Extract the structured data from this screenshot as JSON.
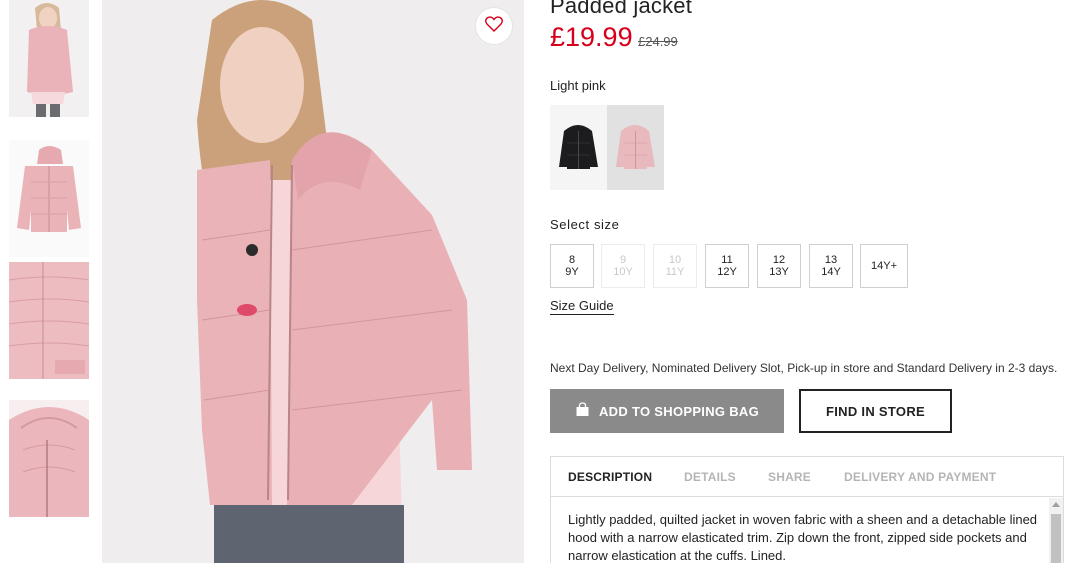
{
  "product": {
    "title": "Padded jacket",
    "price": "£19.99",
    "old_price": "£24.99"
  },
  "colors": {
    "selected_label": "Light pink",
    "swatches": [
      {
        "name": "black",
        "hex": "#1c1c1e"
      },
      {
        "name": "light-pink",
        "hex": "#e8b9bd"
      }
    ]
  },
  "sizes": {
    "label": "Select size",
    "options": [
      {
        "line1": "8",
        "line2": "9Y",
        "available": true
      },
      {
        "line1": "9",
        "line2": "10Y",
        "available": false
      },
      {
        "line1": "10",
        "line2": "11Y",
        "available": false
      },
      {
        "line1": "11",
        "line2": "12Y",
        "available": true
      },
      {
        "line1": "12",
        "line2": "13Y",
        "available": true
      },
      {
        "line1": "13",
        "line2": "14Y",
        "available": true
      },
      {
        "line1": "14Y+",
        "line2": "",
        "available": true
      }
    ],
    "guide_label": "Size Guide"
  },
  "delivery_text": "Next Day Delivery, Nominated Delivery Slot, Pick-up in store and Standard Delivery in 2-3 days.",
  "actions": {
    "add_to_bag": "ADD TO SHOPPING BAG",
    "find_in_store": "FIND IN STORE"
  },
  "info_panel": {
    "tabs": [
      "DESCRIPTION",
      "DETAILS",
      "SHARE",
      "DELIVERY AND PAYMENT"
    ],
    "active_tab": "DESCRIPTION",
    "description": "Lightly padded, quilted jacket in woven fabric with a sheen and a detachable lined hood with a narrow elasticated trim. Zip down the front, zipped side pockets and narrow elastication at the cuffs. Lined."
  },
  "icons": {
    "favorite": "heart-icon",
    "bag": "shopping-bag-icon",
    "scroll_up": "scroll-up-arrow-icon"
  },
  "theme": {
    "price_color": "#d6001c",
    "jacket_pink": "#eab3b8",
    "button_grey": "#8a8a8a"
  }
}
